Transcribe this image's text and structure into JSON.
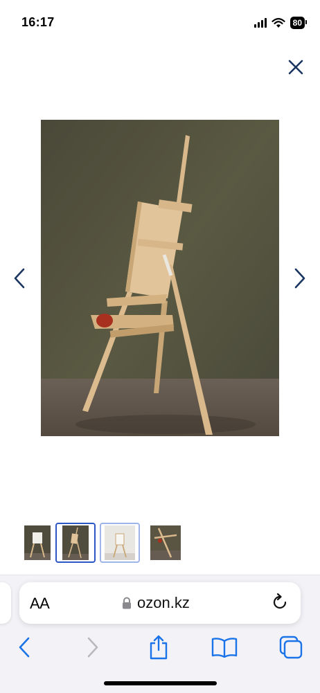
{
  "status_bar": {
    "time": "16:17",
    "battery": "80"
  },
  "viewer": {
    "current_image": "wooden-easel-photo"
  },
  "thumbnails": [
    {
      "name": "thumb-1",
      "selected": false
    },
    {
      "name": "thumb-2",
      "selected": true
    },
    {
      "name": "thumb-3",
      "selected": false
    },
    {
      "name": "thumb-4",
      "selected": false
    }
  ],
  "browser": {
    "text_size_label": "AA",
    "url": "ozon.kz",
    "accent_color": "#1a73e8"
  },
  "icons": {
    "close": "close-icon",
    "prev": "chevron-left-icon",
    "next": "chevron-right-icon",
    "lock": "lock-icon",
    "reload": "reload-icon",
    "back": "back-icon",
    "forward": "forward-icon",
    "share": "share-icon",
    "bookmarks": "bookmarks-icon",
    "tabs": "tabs-icon"
  }
}
